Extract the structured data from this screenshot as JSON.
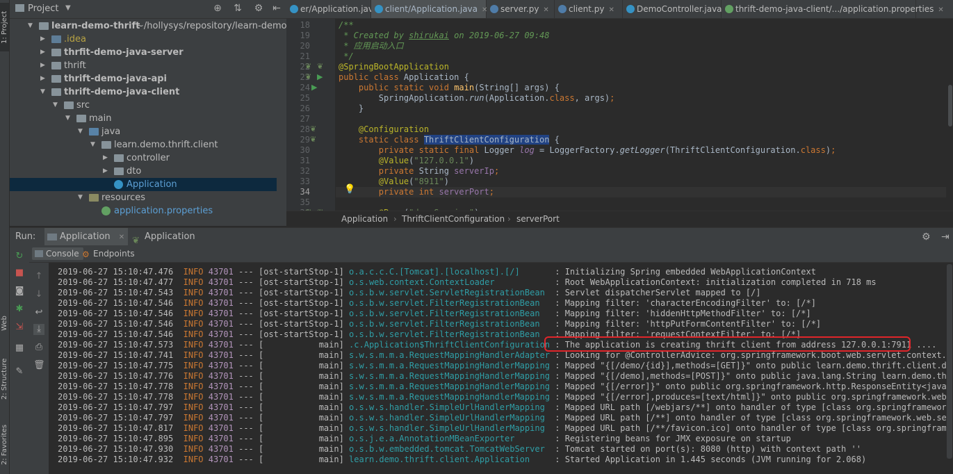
{
  "left_strip": {
    "project": "1: Project",
    "web": "Web",
    "structure": "2: Structure",
    "favorites": "2: Favorites"
  },
  "project_panel": {
    "title": "Project",
    "icons": [
      "target-icon",
      "collapse-icon",
      "gear-icon",
      "hide-icon"
    ],
    "tree": [
      {
        "label": "learn-demo-thrift",
        "extra": "~/hollysys/repository/learn-demo-th",
        "depth": 0,
        "open": true,
        "kind": "mod",
        "bold": true
      },
      {
        "label": ".idea",
        "depth": 1,
        "open": false,
        "kind": "idea",
        "color": "#b8a343"
      },
      {
        "label": "thrfit-demo-java-server",
        "depth": 1,
        "open": false,
        "kind": "mod",
        "bold": true
      },
      {
        "label": "thrift",
        "depth": 1,
        "open": false,
        "kind": "folder"
      },
      {
        "label": "thrift-demo-java-api",
        "depth": 1,
        "open": false,
        "kind": "mod",
        "bold": true
      },
      {
        "label": "thrift-demo-java-client",
        "depth": 1,
        "open": true,
        "kind": "mod",
        "bold": true
      },
      {
        "label": "src",
        "depth": 2,
        "open": true,
        "kind": "folder"
      },
      {
        "label": "main",
        "depth": 3,
        "open": true,
        "kind": "folder"
      },
      {
        "label": "java",
        "depth": 4,
        "open": true,
        "kind": "src"
      },
      {
        "label": "learn.demo.thrift.client",
        "depth": 5,
        "open": true,
        "kind": "pkg"
      },
      {
        "label": "controller",
        "depth": 6,
        "open": false,
        "kind": "pkg"
      },
      {
        "label": "dto",
        "depth": 6,
        "open": false,
        "kind": "pkg"
      },
      {
        "label": "Application",
        "depth": 6,
        "kind": "class",
        "selected": true,
        "color": "#5c9fd4"
      },
      {
        "label": "resources",
        "depth": 4,
        "open": true,
        "kind": "res"
      },
      {
        "label": "application.properties",
        "depth": 5,
        "kind": "props",
        "color": "#5c9fd4"
      }
    ]
  },
  "editor": {
    "tabs": [
      {
        "label": "er/Application.java",
        "active": false,
        "icon": "class-icon",
        "color": "#3592c4"
      },
      {
        "label": "client/Application.java",
        "active": true,
        "icon": "class-icon",
        "color": "#3592c4"
      },
      {
        "label": "server.py",
        "active": false,
        "icon": "python-icon",
        "color": "#4f7ca8"
      },
      {
        "label": "client.py",
        "active": false,
        "icon": "python-icon",
        "color": "#4f7ca8"
      },
      {
        "label": "DemoController.java",
        "active": false,
        "icon": "class-icon",
        "color": "#3592c4"
      },
      {
        "label": "thrift-demo-java-client/.../application.properties",
        "active": false,
        "icon": "properties-icon",
        "color": "#62a062"
      }
    ],
    "line_numbers": [
      "18",
      "19",
      "20",
      "21",
      "22",
      "23",
      "24",
      "25",
      "26",
      "27",
      "28",
      "29",
      "30",
      "31",
      "32",
      "33",
      "34",
      "35",
      "36"
    ],
    "breadcrumbs": [
      "Application",
      "ThriftClientConfiguration",
      "serverPort"
    ]
  },
  "run_panel": {
    "label": "Run:",
    "tabs": [
      {
        "label": "Application",
        "active": true
      },
      {
        "label": "Application",
        "active": false
      }
    ],
    "sub_tabs": [
      {
        "label": "Console",
        "active": true
      },
      {
        "label": "Endpoints",
        "active": false
      }
    ],
    "log": [
      {
        "ts": "2019-06-27 15:10:47.476",
        "level": "INFO",
        "pid": "43701",
        "sep": "---",
        "thread": "[ost-startStop-1]",
        "cls": "o.a.c.c.C.[Tomcat].[localhost].[/]      ",
        "msg": ": Initializing Spring embedded WebApplicationContext"
      },
      {
        "ts": "2019-06-27 15:10:47.477",
        "level": "INFO",
        "pid": "43701",
        "sep": "---",
        "thread": "[ost-startStop-1]",
        "cls": "o.s.web.context.ContextLoader           ",
        "msg": ": Root WebApplicationContext: initialization completed in 718 ms"
      },
      {
        "ts": "2019-06-27 15:10:47.543",
        "level": "INFO",
        "pid": "43701",
        "sep": "---",
        "thread": "[ost-startStop-1]",
        "cls": "o.s.b.w.servlet.ServletRegistrationBean ",
        "msg": ": Servlet dispatcherServlet mapped to [/]"
      },
      {
        "ts": "2019-06-27 15:10:47.546",
        "level": "INFO",
        "pid": "43701",
        "sep": "---",
        "thread": "[ost-startStop-1]",
        "cls": "o.s.b.w.servlet.FilterRegistrationBean  ",
        "msg": ": Mapping filter: 'characterEncodingFilter' to: [/*]"
      },
      {
        "ts": "2019-06-27 15:10:47.546",
        "level": "INFO",
        "pid": "43701",
        "sep": "---",
        "thread": "[ost-startStop-1]",
        "cls": "o.s.b.w.servlet.FilterRegistrationBean  ",
        "msg": ": Mapping filter: 'hiddenHttpMethodFilter' to: [/*]"
      },
      {
        "ts": "2019-06-27 15:10:47.546",
        "level": "INFO",
        "pid": "43701",
        "sep": "---",
        "thread": "[ost-startStop-1]",
        "cls": "o.s.b.w.servlet.FilterRegistrationBean  ",
        "msg": ": Mapping filter: 'httpPutFormContentFilter' to: [/*]"
      },
      {
        "ts": "2019-06-27 15:10:47.546",
        "level": "INFO",
        "pid": "43701",
        "sep": "---",
        "thread": "[ost-startStop-1]",
        "cls": "o.s.b.w.servlet.FilterRegistrationBean  ",
        "msg": ": Mapping filter: 'requestContextFilter' to: [/*]"
      },
      {
        "ts": "2019-06-27 15:10:47.573",
        "level": "INFO",
        "pid": "43701",
        "sep": "---",
        "thread": "[           main]",
        "cls": ".c.Application$ThriftClientConfiguration",
        "msg": ": The application is creating thrift client from address 127.0.0.1:7911 ...."
      },
      {
        "ts": "2019-06-27 15:10:47.741",
        "level": "INFO",
        "pid": "43701",
        "sep": "---",
        "thread": "[           main]",
        "cls": "s.w.s.m.m.a.RequestMappingHandlerAdapter",
        "msg": ": Looking for @ControllerAdvice: org.springframework.boot.web.servlet.context.Annota"
      },
      {
        "ts": "2019-06-27 15:10:47.775",
        "level": "INFO",
        "pid": "43701",
        "sep": "---",
        "thread": "[           main]",
        "cls": "s.w.s.m.m.a.RequestMappingHandlerMapping",
        "msg": ": Mapped \"{[/demo/{id}],methods=[GET]}\" onto public learn.demo.thrift.client.dto.Der"
      },
      {
        "ts": "2019-06-27 15:10:47.776",
        "level": "INFO",
        "pid": "43701",
        "sep": "---",
        "thread": "[           main]",
        "cls": "s.w.s.m.m.a.RequestMappingHandlerMapping",
        "msg": ": Mapped \"{[/demo],methods=[POST]}\" onto public java.lang.String learn.demo.thrift.c"
      },
      {
        "ts": "2019-06-27 15:10:47.778",
        "level": "INFO",
        "pid": "43701",
        "sep": "---",
        "thread": "[           main]",
        "cls": "s.w.s.m.m.a.RequestMappingHandlerMapping",
        "msg": ": Mapped \"{[/error]}\" onto public org.springframework.http.ResponseEntity<java.util."
      },
      {
        "ts": "2019-06-27 15:10:47.778",
        "level": "INFO",
        "pid": "43701",
        "sep": "---",
        "thread": "[           main]",
        "cls": "s.w.s.m.m.a.RequestMappingHandlerMapping",
        "msg": ": Mapped \"{[/error],produces=[text/html]}\" onto public org.springframework.web.servl"
      },
      {
        "ts": "2019-06-27 15:10:47.797",
        "level": "INFO",
        "pid": "43701",
        "sep": "---",
        "thread": "[           main]",
        "cls": "o.s.w.s.handler.SimpleUrlHandlerMapping ",
        "msg": ": Mapped URL path [/webjars/**] onto handler of type [class org.springframework.web."
      },
      {
        "ts": "2019-06-27 15:10:47.797",
        "level": "INFO",
        "pid": "43701",
        "sep": "---",
        "thread": "[           main]",
        "cls": "o.s.w.s.handler.SimpleUrlHandlerMapping ",
        "msg": ": Mapped URL path [/**] onto handler of type [class org.springframework.web.servlet."
      },
      {
        "ts": "2019-06-27 15:10:47.817",
        "level": "INFO",
        "pid": "43701",
        "sep": "---",
        "thread": "[           main]",
        "cls": "o.s.w.s.handler.SimpleUrlHandlerMapping ",
        "msg": ": Mapped URL path [/**/favicon.ico] onto handler of type [class org.springframework."
      },
      {
        "ts": "2019-06-27 15:10:47.895",
        "level": "INFO",
        "pid": "43701",
        "sep": "---",
        "thread": "[           main]",
        "cls": "o.s.j.e.a.AnnotationMBeanExporter       ",
        "msg": ": Registering beans for JMX exposure on startup"
      },
      {
        "ts": "2019-06-27 15:10:47.930",
        "level": "INFO",
        "pid": "43701",
        "sep": "---",
        "thread": "[           main]",
        "cls": "o.s.b.w.embedded.tomcat.TomcatWebServer ",
        "msg": ": Tomcat started on port(s): 8080 (http) with context path ''"
      },
      {
        "ts": "2019-06-27 15:10:47.932",
        "level": "INFO",
        "pid": "43701",
        "sep": "---",
        "thread": "[           main]",
        "cls": "learn.demo.thrift.client.Application    ",
        "msg": ": Started Application in 1.445 seconds (JVM running for 2.068)"
      }
    ]
  }
}
